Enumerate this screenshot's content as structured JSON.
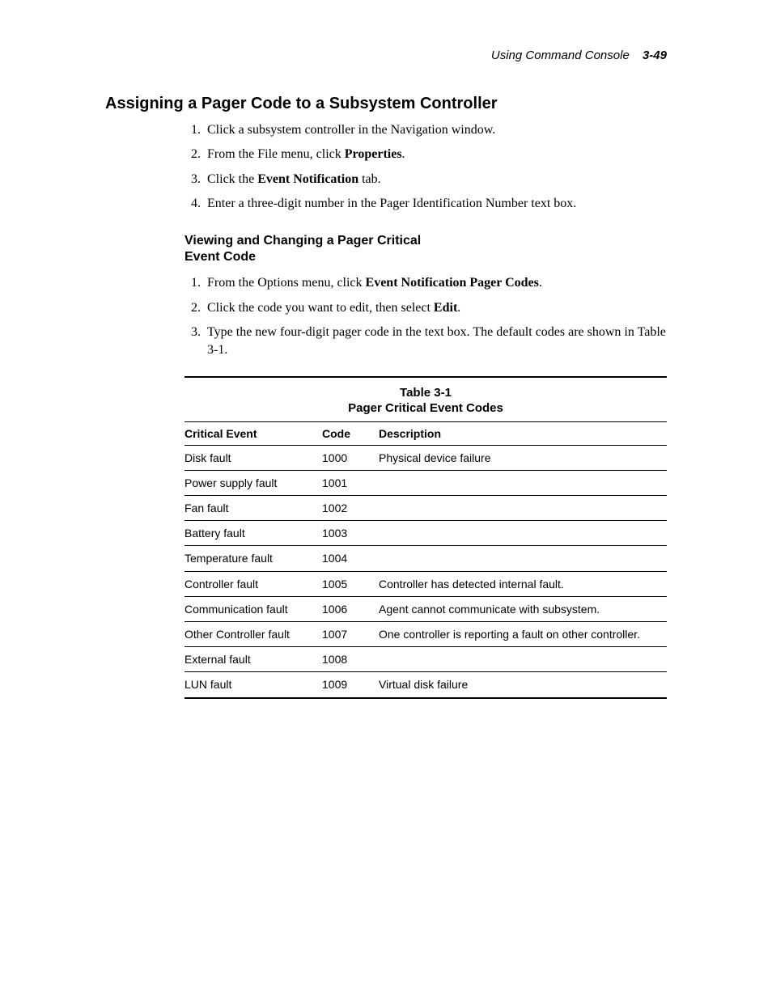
{
  "header": {
    "running_title": "Using Command Console",
    "page_number": "3-49"
  },
  "section": {
    "title": "Assigning a Pager Code to a Subsystem Controller",
    "steps": [
      {
        "text": "Click a subsystem controller in the Navigation window."
      },
      {
        "pre": "From the File menu, click ",
        "bold": "Properties",
        "post": "."
      },
      {
        "pre": "Click the ",
        "bold": "Event Notification",
        "post": " tab."
      },
      {
        "text": "Enter a three-digit number in the Pager Identification Number text box."
      }
    ]
  },
  "subsection": {
    "title": "Viewing and Changing a Pager Critical Event Code",
    "steps": [
      {
        "pre": "From the Options menu, click ",
        "bold": "Event Notification Pager Codes",
        "post": "."
      },
      {
        "pre": "Click the code you want to edit, then select ",
        "bold": "Edit",
        "post": "."
      },
      {
        "text": "Type the new four-digit pager code in the text box. The default codes are shown in Table 3-1."
      }
    ]
  },
  "table": {
    "label": "Table 3-1",
    "caption": "Pager Critical Event Codes",
    "headers": {
      "c1": "Critical Event",
      "c2": "Code",
      "c3": "Description"
    },
    "rows": [
      {
        "event": "Disk fault",
        "code": "1000",
        "desc": "Physical device failure"
      },
      {
        "event": "Power supply fault",
        "code": "1001",
        "desc": ""
      },
      {
        "event": "Fan fault",
        "code": "1002",
        "desc": ""
      },
      {
        "event": "Battery fault",
        "code": "1003",
        "desc": ""
      },
      {
        "event": "Temperature fault",
        "code": "1004",
        "desc": ""
      },
      {
        "event": "Controller fault",
        "code": "1005",
        "desc": "Controller has detected internal fault."
      },
      {
        "event": "Communication fault",
        "code": "1006",
        "desc": "Agent cannot communicate with subsystem."
      },
      {
        "event": "Other Controller fault",
        "code": "1007",
        "desc": "One controller is reporting a fault on other controller."
      },
      {
        "event": "External fault",
        "code": "1008",
        "desc": ""
      },
      {
        "event": "LUN fault",
        "code": "1009",
        "desc": "Virtual disk failure"
      }
    ]
  }
}
